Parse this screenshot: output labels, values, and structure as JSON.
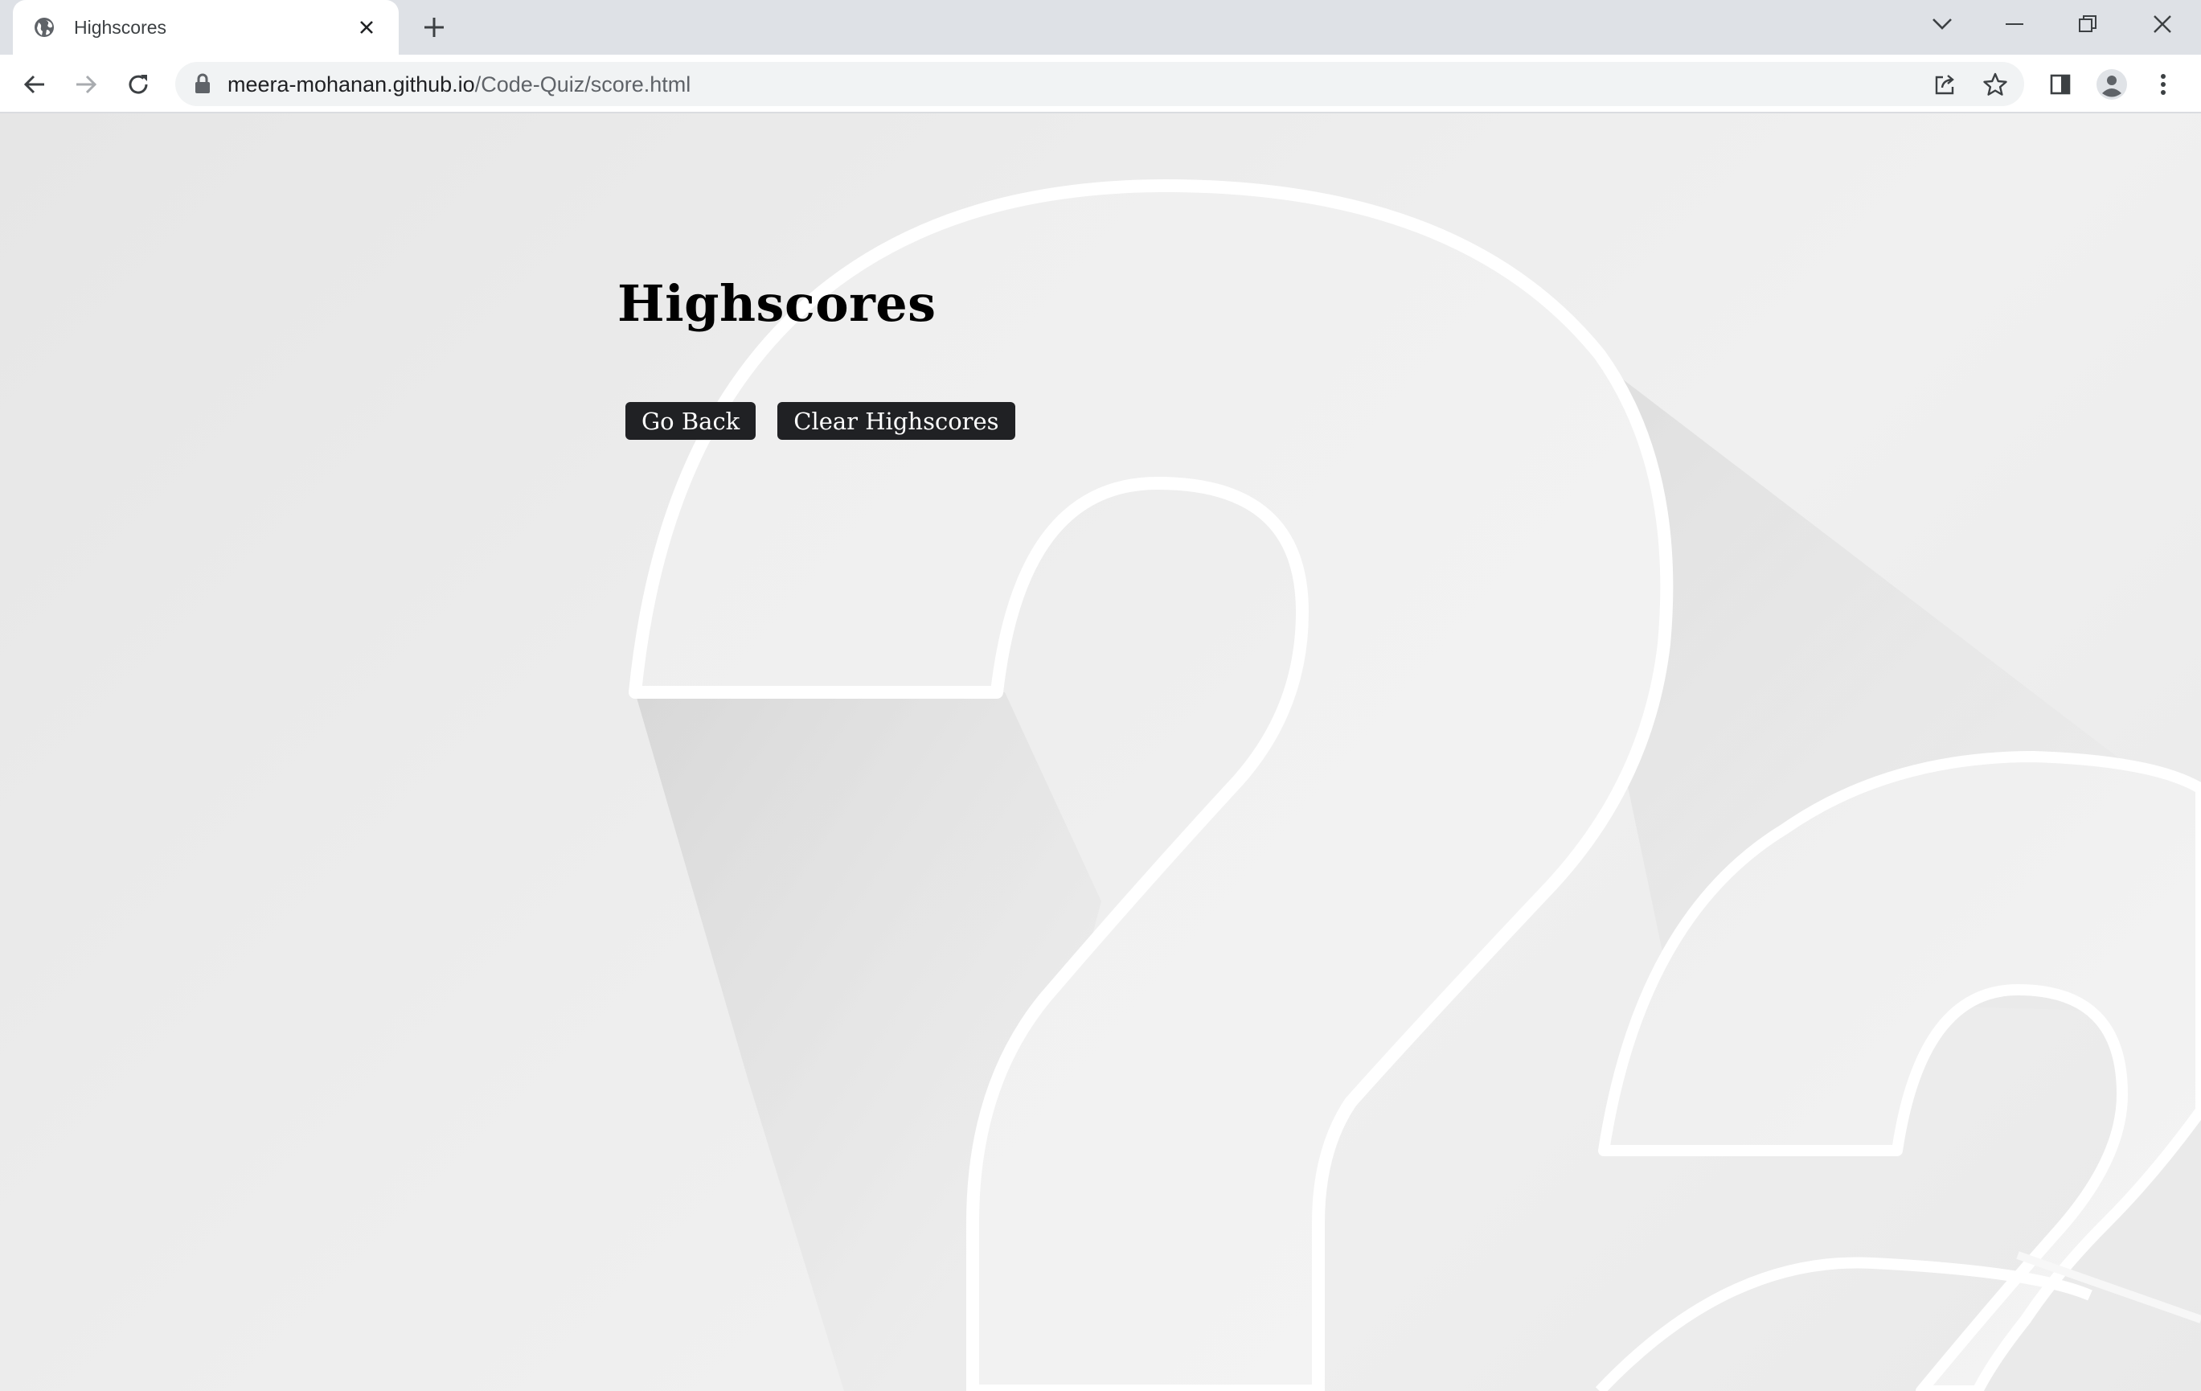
{
  "browser": {
    "tab_title": "Highscores",
    "url_host": "meera-mohanan.github.io",
    "url_path": "/Code-Quiz/score.html",
    "icons": [
      "globe-icon",
      "close-icon",
      "plus-icon",
      "chevron-down-icon",
      "minimize-icon",
      "restore-icon",
      "close-window-icon",
      "back-arrow-icon",
      "forward-arrow-icon",
      "reload-icon",
      "lock-icon",
      "share-icon",
      "star-icon",
      "side-panel-icon",
      "profile-icon",
      "more-vertical-icon"
    ]
  },
  "page": {
    "title": "Highscores",
    "buttons": {
      "go_back": "Go Back",
      "clear": "Clear Highscores"
    },
    "background": "large-question-marks"
  },
  "colors": {
    "button_bg": "#202124",
    "button_text": "#ffffff",
    "page_bg": "#ececec"
  }
}
